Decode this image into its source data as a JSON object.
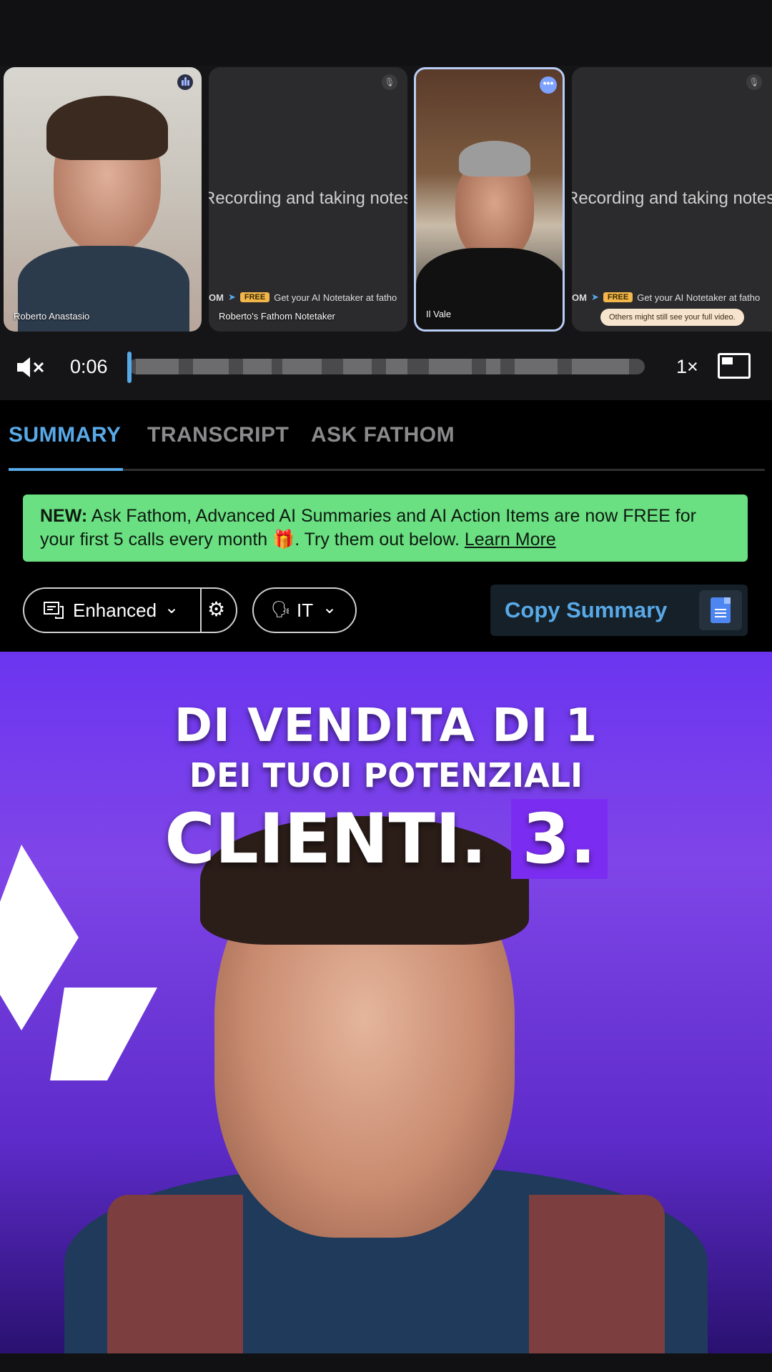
{
  "participants": [
    {
      "name": "Roberto Anastasio",
      "has_video": true,
      "status_icon": "speaking-bars-icon"
    },
    {
      "name": "Roberto's Fathom Notetaker",
      "has_video": false,
      "status_icon": "muted-mic-icon",
      "placeholder_text": "Recording and taking notes",
      "free_row_prefix": "OM",
      "free_badge": "FREE",
      "free_row_text": "Get your AI Notetaker at fatho"
    },
    {
      "name": "Il Vale",
      "has_video": true,
      "status_icon": "more-options-icon",
      "active": true
    },
    {
      "name": "",
      "has_video": false,
      "status_icon": "muted-mic-icon",
      "placeholder_text": "Recording and taking notes",
      "free_row_prefix": "OM",
      "free_badge": "FREE",
      "free_row_text": "Get your AI Notetaker at fatho",
      "badge": "Others might still see your full video."
    }
  ],
  "player": {
    "mute_icon": "mute-speaker-icon",
    "time": "0:06",
    "speed": "1×",
    "pip_icon": "picture-in-picture-icon",
    "progress": 0.0
  },
  "tabs": [
    {
      "label": "SUMMARY",
      "active": true
    },
    {
      "label": "TRANSCRIPT",
      "active": false
    },
    {
      "label": "ASK FATHOM",
      "active": false
    }
  ],
  "banner": {
    "new_label": "NEW:",
    "text": " Ask Fathom, Advanced AI Summaries and AI Action Items are now FREE for your first 5 calls every month 🎁. Try them out below. ",
    "link": "Learn More"
  },
  "toolbar": {
    "mode_label": "Enhanced",
    "language_label": "IT",
    "copy_label": "Copy Summary"
  },
  "video_caption": {
    "line1": "DI VENDITA DI 1",
    "line2": "DEI TUOI POTENZIALI",
    "line3a": "CLIENTI.",
    "line3b": "3."
  },
  "colors": {
    "accent": "#58a9e8",
    "banner_bg": "#6ae082",
    "free_badge": "#f2b64a",
    "caption_highlight": "#7a2df0"
  }
}
